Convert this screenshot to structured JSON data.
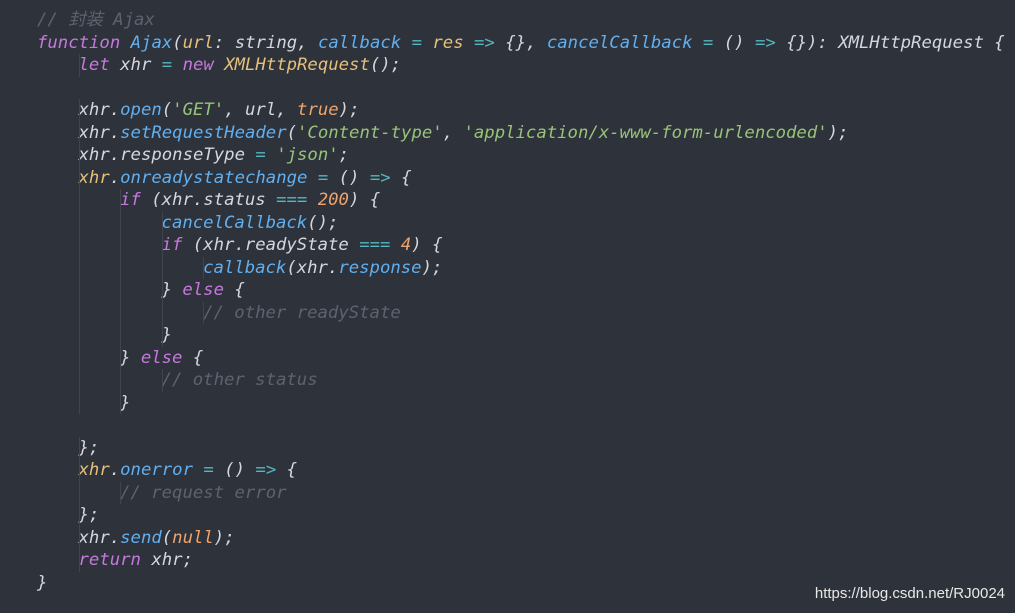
{
  "lines": [
    {
      "tokens": [
        {
          "t": "// 封装 Ajax",
          "c": "cmt"
        }
      ]
    },
    {
      "tokens": [
        {
          "t": "function",
          "c": "kw"
        },
        {
          "t": " ",
          "c": "punc"
        },
        {
          "t": "Ajax",
          "c": "fn"
        },
        {
          "t": "(",
          "c": "punc"
        },
        {
          "t": "url",
          "c": "param"
        },
        {
          "t": ": string, ",
          "c": "punc"
        },
        {
          "t": "callback",
          "c": "fn"
        },
        {
          "t": " = ",
          "c": "op"
        },
        {
          "t": "res",
          "c": "param"
        },
        {
          "t": " => ",
          "c": "op"
        },
        {
          "t": "{}",
          "c": "punc"
        },
        {
          "t": ", ",
          "c": "punc"
        },
        {
          "t": "cancelCallback",
          "c": "fn"
        },
        {
          "t": " = ",
          "c": "op"
        },
        {
          "t": "()",
          "c": "punc"
        },
        {
          "t": " => ",
          "c": "op"
        },
        {
          "t": "{}",
          "c": "punc"
        },
        {
          "t": "): XMLHttpRequest {",
          "c": "punc"
        }
      ]
    },
    {
      "tokens": [
        {
          "t": "let",
          "c": "kw"
        },
        {
          "t": " xhr ",
          "c": "punc"
        },
        {
          "t": "=",
          "c": "op"
        },
        {
          "t": " ",
          "c": "punc"
        },
        {
          "t": "new",
          "c": "kw"
        },
        {
          "t": " ",
          "c": "punc"
        },
        {
          "t": "XMLHttpRequest",
          "c": "cls"
        },
        {
          "t": "();",
          "c": "punc"
        }
      ]
    },
    {
      "tokens": []
    },
    {
      "tokens": [
        {
          "t": "xhr",
          "c": "punc"
        },
        {
          "t": ".",
          "c": "punc"
        },
        {
          "t": "open",
          "c": "method"
        },
        {
          "t": "(",
          "c": "punc"
        },
        {
          "t": "'GET'",
          "c": "str"
        },
        {
          "t": ", url, ",
          "c": "punc"
        },
        {
          "t": "true",
          "c": "bool"
        },
        {
          "t": ");",
          "c": "punc"
        }
      ]
    },
    {
      "tokens": [
        {
          "t": "xhr",
          "c": "punc"
        },
        {
          "t": ".",
          "c": "punc"
        },
        {
          "t": "setRequestHeader",
          "c": "method"
        },
        {
          "t": "(",
          "c": "punc"
        },
        {
          "t": "'Content-type'",
          "c": "str"
        },
        {
          "t": ", ",
          "c": "punc"
        },
        {
          "t": "'application/x-www-form-urlencoded'",
          "c": "str"
        },
        {
          "t": ");",
          "c": "punc"
        }
      ]
    },
    {
      "tokens": [
        {
          "t": "xhr",
          "c": "punc"
        },
        {
          "t": ".",
          "c": "punc"
        },
        {
          "t": "responseType",
          "c": "prop"
        },
        {
          "t": " = ",
          "c": "op"
        },
        {
          "t": "'json'",
          "c": "str"
        },
        {
          "t": ";",
          "c": "punc"
        }
      ]
    },
    {
      "tokens": [
        {
          "t": "xhr",
          "c": "yellowvar"
        },
        {
          "t": ".",
          "c": "punc"
        },
        {
          "t": "onreadystatechange",
          "c": "method"
        },
        {
          "t": " = ",
          "c": "op"
        },
        {
          "t": "()",
          "c": "punc"
        },
        {
          "t": " => ",
          "c": "op"
        },
        {
          "t": "{",
          "c": "punc"
        }
      ]
    },
    {
      "tokens": [
        {
          "t": "if",
          "c": "kw"
        },
        {
          "t": " (xhr.status ",
          "c": "punc"
        },
        {
          "t": "===",
          "c": "op"
        },
        {
          "t": " ",
          "c": "punc"
        },
        {
          "t": "200",
          "c": "num"
        },
        {
          "t": ") {",
          "c": "punc"
        }
      ]
    },
    {
      "tokens": [
        {
          "t": "cancelCallback",
          "c": "fn"
        },
        {
          "t": "();",
          "c": "punc"
        }
      ]
    },
    {
      "tokens": [
        {
          "t": "if",
          "c": "kw"
        },
        {
          "t": " (xhr.readyState ",
          "c": "punc"
        },
        {
          "t": "===",
          "c": "op"
        },
        {
          "t": " ",
          "c": "punc"
        },
        {
          "t": "4",
          "c": "num"
        },
        {
          "t": ") {",
          "c": "punc"
        }
      ]
    },
    {
      "tokens": [
        {
          "t": "callback",
          "c": "fn"
        },
        {
          "t": "(xhr.",
          "c": "punc"
        },
        {
          "t": "response",
          "c": "method"
        },
        {
          "t": ");",
          "c": "punc"
        }
      ]
    },
    {
      "tokens": [
        {
          "t": "}",
          "c": "punc"
        },
        {
          "t": " ",
          "c": "punc"
        },
        {
          "t": "else",
          "c": "kw"
        },
        {
          "t": " {",
          "c": "punc"
        }
      ]
    },
    {
      "tokens": [
        {
          "t": "// other readyState",
          "c": "cmt"
        }
      ]
    },
    {
      "tokens": [
        {
          "t": "}",
          "c": "punc"
        }
      ]
    },
    {
      "tokens": [
        {
          "t": "}",
          "c": "punc"
        },
        {
          "t": " ",
          "c": "punc"
        },
        {
          "t": "else",
          "c": "kw"
        },
        {
          "t": " {",
          "c": "punc"
        }
      ]
    },
    {
      "tokens": [
        {
          "t": "// other status",
          "c": "cmt"
        }
      ]
    },
    {
      "tokens": [
        {
          "t": "}",
          "c": "punc"
        }
      ]
    },
    {
      "tokens": []
    },
    {
      "tokens": [
        {
          "t": "};",
          "c": "punc"
        }
      ]
    },
    {
      "tokens": [
        {
          "t": "xhr",
          "c": "yellowvar"
        },
        {
          "t": ".",
          "c": "punc"
        },
        {
          "t": "onerror",
          "c": "method"
        },
        {
          "t": " = ",
          "c": "op"
        },
        {
          "t": "()",
          "c": "punc"
        },
        {
          "t": " => ",
          "c": "op"
        },
        {
          "t": "{",
          "c": "punc"
        }
      ]
    },
    {
      "tokens": [
        {
          "t": "// request error",
          "c": "cmt"
        }
      ]
    },
    {
      "tokens": [
        {
          "t": "};",
          "c": "punc"
        }
      ]
    },
    {
      "tokens": [
        {
          "t": "xhr",
          "c": "punc"
        },
        {
          "t": ".",
          "c": "punc"
        },
        {
          "t": "send",
          "c": "method"
        },
        {
          "t": "(",
          "c": "punc"
        },
        {
          "t": "null",
          "c": "bool"
        },
        {
          "t": ");",
          "c": "punc"
        }
      ]
    },
    {
      "tokens": [
        {
          "t": "return",
          "c": "kw"
        },
        {
          "t": " xhr;",
          "c": "punc"
        }
      ]
    },
    {
      "tokens": [
        {
          "t": "}",
          "c": "punc"
        }
      ]
    }
  ],
  "watermark": "https://blog.csdn.net/RJ0024",
  "colors": {
    "background": "#2e323a",
    "keyword": "#c678dd",
    "function": "#61afef",
    "class": "#e5c07b",
    "string": "#98c379",
    "number": "#f0a36b",
    "comment": "#5c6370"
  }
}
